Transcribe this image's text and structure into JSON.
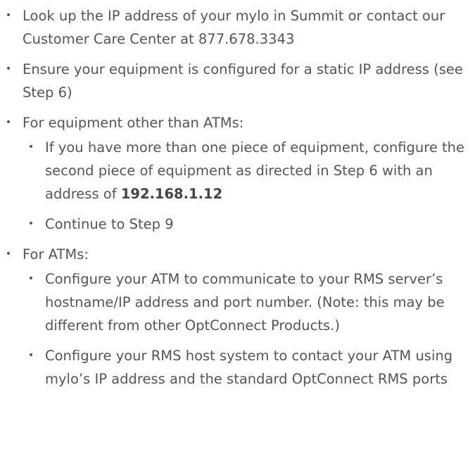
{
  "bullet_char": "•",
  "items": [
    {
      "text": "Look up the IP address of your mylo in Summit or contact our Customer Care Center at 877.678.3343"
    },
    {
      "text": "Ensure your equipment is configured for a static IP address (see Step 6)"
    },
    {
      "text": "For equipment other than ATMs:",
      "subitems": [
        {
          "text": "If you have more than one piece of equipment, configure the second piece of equipment as directed in Step 6 with an address of ",
          "emphasis": "192.168.1.12"
        },
        {
          "text": "Continue to Step 9"
        }
      ]
    },
    {
      "text": "For ATMs:",
      "subitems": [
        {
          "text": "Configure your ATM to communicate to your RMS server’s hostname/IP address and port number. (Note: this may be different from other OptConnect Products.)"
        },
        {
          "text": "Configure your RMS host system to contact your ATM using mylo’s IP address and the standard OptConnect RMS ports"
        }
      ]
    }
  ]
}
